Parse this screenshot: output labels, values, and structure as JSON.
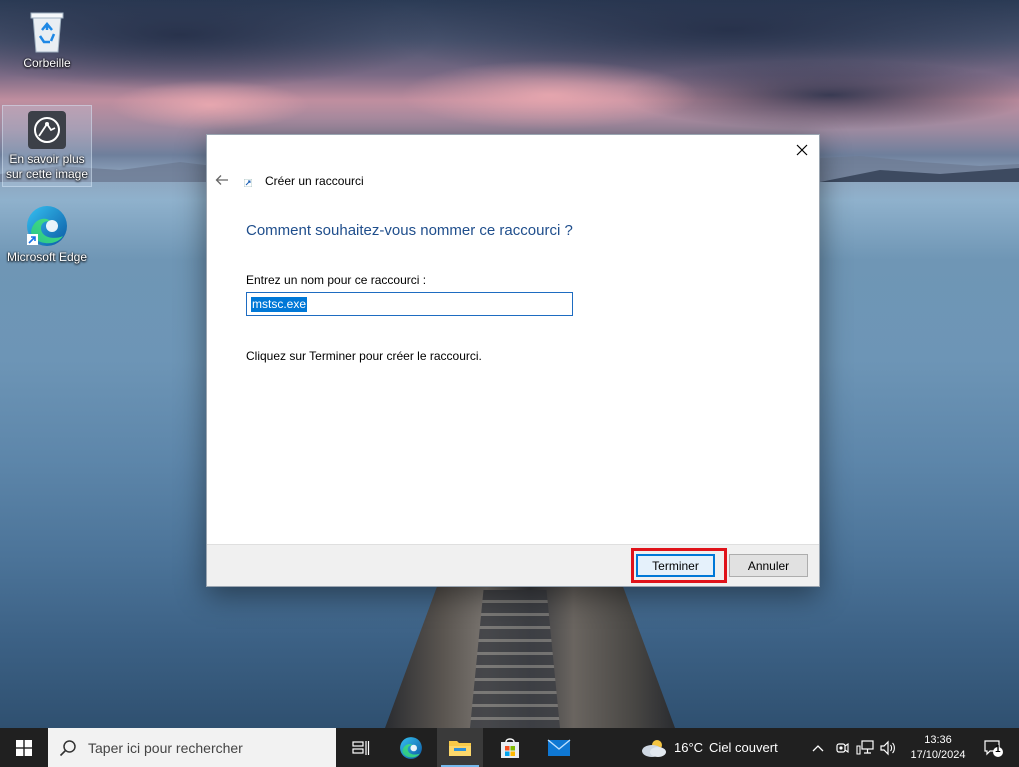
{
  "desktop": {
    "icons": [
      {
        "label": "Corbeille"
      },
      {
        "label": "En savoir plus sur cette image"
      },
      {
        "label": "Microsoft Edge"
      }
    ]
  },
  "dialog": {
    "title": "Créer un raccourci",
    "heading": "Comment souhaitez-vous nommer ce raccourci ?",
    "field_label": "Entrez un nom pour ce raccourci :",
    "field_value": "mstsc.exe",
    "hint": "Cliquez sur Terminer pour créer le raccourci.",
    "finish_label": "Terminer",
    "cancel_label": "Annuler",
    "accent_color": "#0078d7",
    "highlight_color": "#e0131a"
  },
  "taskbar": {
    "search_placeholder": "Taper ici pour rechercher",
    "weather": {
      "temperature": "16°C",
      "condition": "Ciel couvert",
      "icon": "cloudy-weather-icon"
    },
    "clock": {
      "time": "13:36",
      "date": "17/10/2024"
    },
    "notification_count": "1",
    "pinned": [
      "task-view",
      "microsoft-edge",
      "file-explorer",
      "microsoft-store",
      "mail"
    ]
  }
}
